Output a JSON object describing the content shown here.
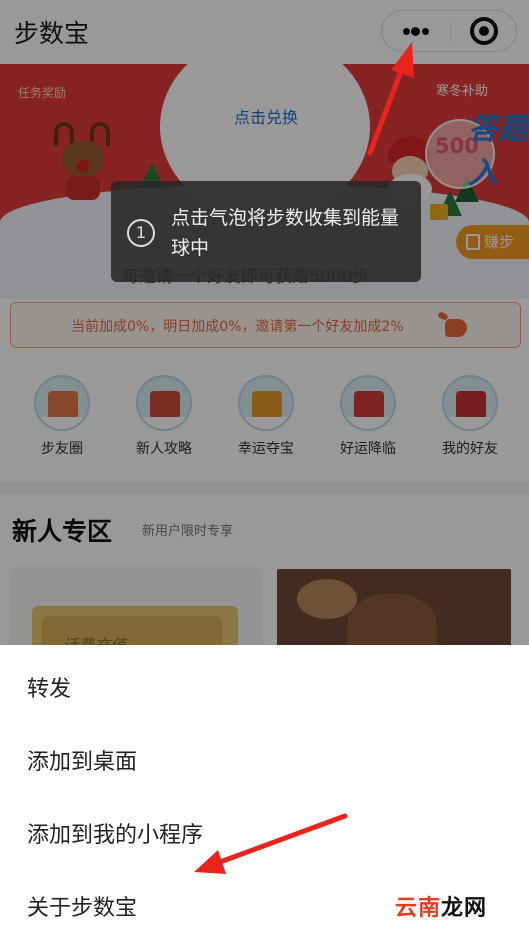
{
  "nav": {
    "title": "步数宝"
  },
  "banner": {
    "redeem_label": "点击兑换",
    "task_reward_label": "任务奖励",
    "winter_subsidy_label": "寒冬补助",
    "bubble_value": "500",
    "promo_text": "答题入",
    "earn_button_label": "赚步",
    "invite_text": "每邀请一个好友即可获赠5000步"
  },
  "toast": {
    "step_number": "1",
    "message": "点击气泡将步数收集到能量球中"
  },
  "bonus_bar": {
    "text": "当前加成0%，明日加成0%，邀请第一个好友加成2%"
  },
  "shortcuts": [
    {
      "label": "步友圈",
      "icon": "cake-icon",
      "color": "#e27a4a"
    },
    {
      "label": "新人攻略",
      "icon": "shop-icon",
      "color": "#c84a3a"
    },
    {
      "label": "幸运夺宝",
      "icon": "treasure-icon",
      "color": "#e89a2a"
    },
    {
      "label": "好运降临",
      "icon": "bell-icon",
      "color": "#d43a3a"
    },
    {
      "label": "我的好友",
      "icon": "house-icon",
      "color": "#c8323a"
    }
  ],
  "new_user_section": {
    "title": "新人专区",
    "subtitle": "新用户限时专享",
    "card_text": "话费充值"
  },
  "action_sheet": {
    "items": [
      {
        "label": "转发"
      },
      {
        "label": "添加到桌面"
      },
      {
        "label": "添加到我的小程序"
      },
      {
        "label": "关于步数宝"
      }
    ]
  },
  "watermark": {
    "text_red": "云南",
    "text_black": "龙网"
  },
  "colors": {
    "banner_red": "#e23b3b",
    "annotation_arrow": "#e8241c",
    "bonus_orange": "#e46a3c",
    "earn_button": "#f39a22"
  }
}
